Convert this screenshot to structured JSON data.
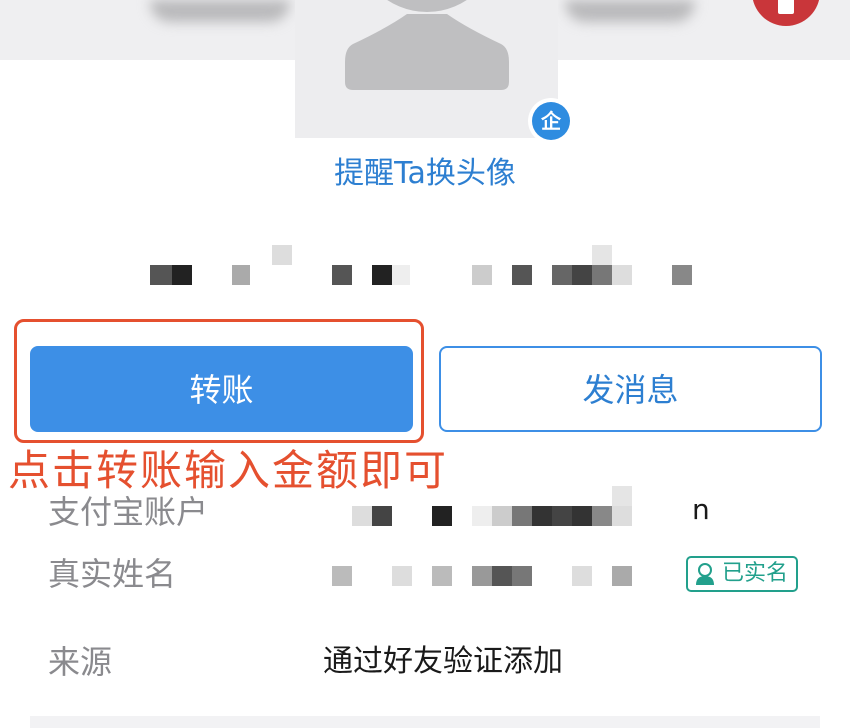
{
  "profile": {
    "remind_avatar_link": "提醒Ta换头像",
    "enterprise_badge": "企"
  },
  "actions": {
    "transfer_label": "转账",
    "message_label": "发消息"
  },
  "annotation": {
    "text": "点击转账输入金额即可",
    "color": "#e5502f"
  },
  "info_rows": [
    {
      "label": "支付宝账户",
      "value_visible": "n"
    },
    {
      "label": "真实姓名",
      "status_tag": "已实名"
    },
    {
      "label": "来源",
      "value": "通过好友验证添加"
    }
  ],
  "colors": {
    "primary": "#3d8fe6",
    "link": "#2d7fd1",
    "verified": "#22a08c",
    "annotation": "#e5502f"
  },
  "icons": {
    "avatar": "person-silhouette-icon",
    "badge": "enterprise-badge-icon",
    "verified": "verified-person-icon"
  }
}
